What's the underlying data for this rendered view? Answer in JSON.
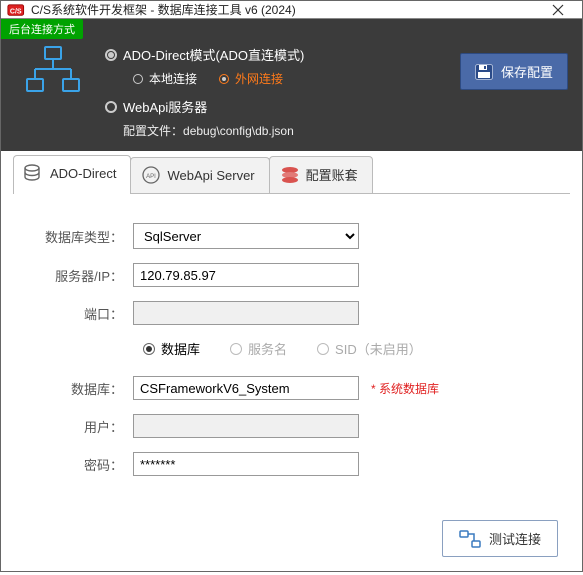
{
  "window": {
    "title": "C/S系统软件开发框架 - 数据库连接工具 v6 (2024)"
  },
  "header": {
    "badge": "后台连接方式",
    "ado_label": "ADO-Direct模式(ADO直连模式)",
    "local_label": "本地连接",
    "wan_label": "外网连接",
    "webapi_label": "WebApi服务器",
    "config_prefix": "配置文件：",
    "config_path": "debug\\config\\db.json",
    "save_button": "保存配置"
  },
  "tabs": [
    {
      "label": "ADO-Direct"
    },
    {
      "label": "WebApi Server"
    },
    {
      "label": "配置账套"
    }
  ],
  "form": {
    "db_type_label": "数据库类型：",
    "db_type_value": "SqlServer",
    "server_label": "服务器/IP：",
    "server_value": "120.79.85.97",
    "port_label": "端口：",
    "port_value": "",
    "radio_db": "数据库",
    "radio_svc": "服务名",
    "radio_sid": "SID（未启用）",
    "db_label": "数据库：",
    "db_value": "CSFrameworkV6_System",
    "db_note": "* 系统数据库",
    "user_label": "用户：",
    "user_value": "",
    "pwd_label": "密码：",
    "pwd_value": "*******"
  },
  "actions": {
    "test_button": "测试连接"
  }
}
